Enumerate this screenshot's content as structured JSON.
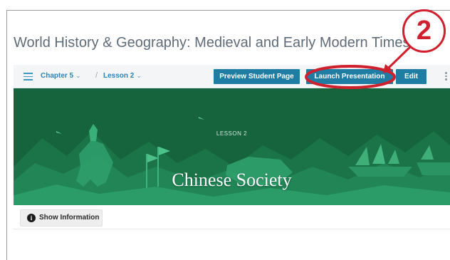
{
  "page": {
    "title": "World History & Geography: Medieval and Early Modern Times"
  },
  "toolbar": {
    "chapter_label": "Chapter 5",
    "separator": "/",
    "lesson_label": "Lesson 2",
    "preview_button": "Preview Student Page",
    "launch_button": "Launch Presentation",
    "edit_button": "Edit"
  },
  "banner": {
    "kicker": "LESSON 2",
    "title": "Chinese Society"
  },
  "info": {
    "button_label": "Show Information"
  },
  "callout": {
    "number": "2"
  },
  "colors": {
    "accent": "#1f7da3",
    "banner": "#16643e",
    "callout": "#d0202e"
  },
  "icons": [
    "menu-icon",
    "chevron-down-icon",
    "more-vertical-icon",
    "info-icon"
  ]
}
